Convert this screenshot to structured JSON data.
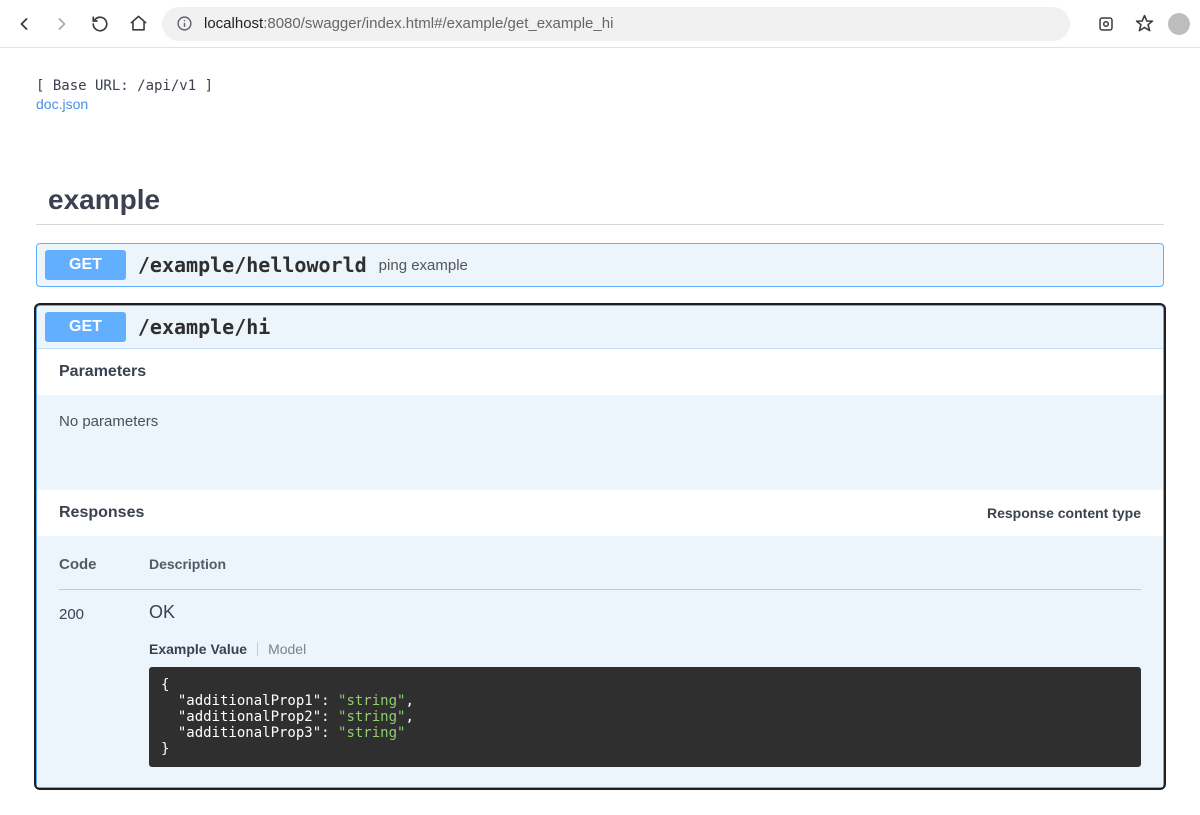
{
  "browser": {
    "url_host": "localhost",
    "url_rest": ":8080/swagger/index.html#/example/get_example_hi"
  },
  "swagger": {
    "base_url_line": "[ Base URL: /api/v1 ]",
    "doc_link": "doc.json",
    "tag": "example",
    "ops": [
      {
        "method": "GET",
        "path": "/example/helloworld",
        "summary": "ping example"
      },
      {
        "method": "GET",
        "path": "/example/hi",
        "summary": ""
      }
    ],
    "parameters_heading": "Parameters",
    "no_params_text": "No parameters",
    "responses_heading": "Responses",
    "response_content_label": "Response content type",
    "code_header": "Code",
    "desc_header": "Description",
    "response_code": "200",
    "response_desc": "OK",
    "tabs": {
      "example_value": "Example Value",
      "model": "Model"
    },
    "example_json": {
      "keys": [
        "additionalProp1",
        "additionalProp2",
        "additionalProp3"
      ],
      "value_type": "string"
    }
  }
}
